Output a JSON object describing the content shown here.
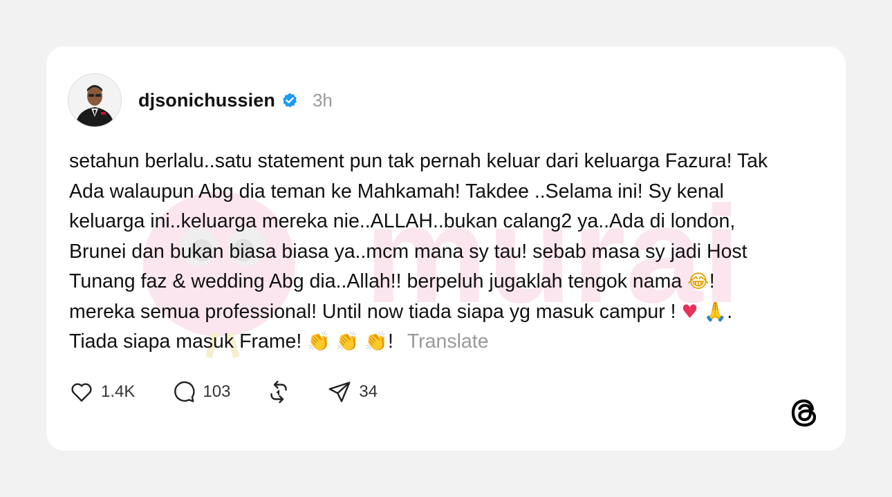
{
  "post": {
    "author": {
      "username": "djsonichussien",
      "verified": true,
      "verified_icon": "verified-badge-icon",
      "time_ago": "3h"
    },
    "text": {
      "lines": [
        "setahun berlalu..satu statement pun tak pernah keluar dari keluarga Fazura! Tak",
        "Ada walaupun Abg dia teman ke Mahkamah! Takdee ..Selama ini! Sy kenal",
        "keluarga ini..keluarga mereka nie..ALLAH..bukan calang2 ya..Ada di london,",
        "Brunei dan bukan biasa biasa ya..mcm mana sy tau! sebab masa sy jadi Host"
      ],
      "line5_before_emoji": "Tunang faz & wedding Abg dia..Allah!! berpeluh jugaklah tengok nama",
      "line5_emoji": "😂",
      "line5_after_emoji": "!",
      "line6_before_emoji": "mereka semua professional! Until now tiada siapa yg masuk campur !",
      "line6_emoji_heart": "♥",
      "line6_emoji_pray": "🙏",
      "line6_after_emoji": ".",
      "line7_before_emoji": "Tiada siapa masuk Frame!",
      "line7_emoji_clap": "👏",
      "line7_after_emoji": "!",
      "translate_label": "Translate"
    },
    "actions": {
      "like": {
        "icon": "heart-icon",
        "count": "1.4K"
      },
      "reply": {
        "icon": "comment-icon",
        "count": "103"
      },
      "repost": {
        "icon": "repost-icon"
      },
      "share": {
        "icon": "send-icon",
        "count": "34"
      }
    },
    "brand_icon": "threads-logo-icon"
  },
  "watermark": {
    "text": "murai"
  },
  "colors": {
    "page_background": "#f2f2f2",
    "card_background": "#ffffff",
    "verified_blue": "#1d9bf0",
    "muted_text": "#9a9a9a",
    "watermark_pink": "#f4a7c6"
  }
}
